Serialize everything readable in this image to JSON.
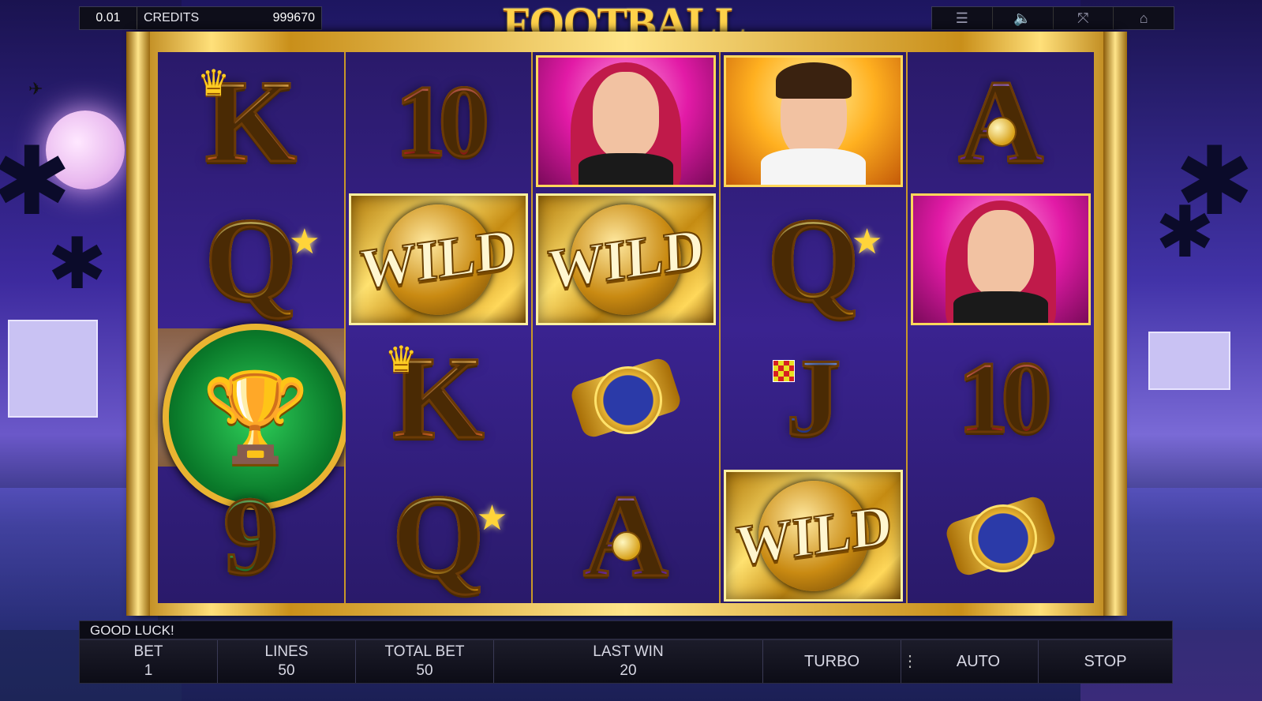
{
  "topbar": {
    "denomination": "0.01",
    "credits_label": "CREDITS",
    "credits_value": "999670",
    "icons": [
      "menu-icon",
      "sound-icon",
      "fullscreen-icon",
      "home-icon"
    ]
  },
  "game": {
    "title": "FOOTBALL SUPERSTAR"
  },
  "reels": [
    {
      "symbols": [
        "K",
        "Q",
        "TROPHY",
        "9"
      ]
    },
    {
      "symbols": [
        "10",
        "WILD",
        "K",
        "Q"
      ]
    },
    {
      "symbols": [
        "GIRL",
        "WILD",
        "WATCH",
        "A"
      ]
    },
    {
      "symbols": [
        "MAN",
        "Q",
        "J",
        "WILD"
      ]
    },
    {
      "symbols": [
        "A",
        "GIRL",
        "10",
        "WATCH"
      ]
    }
  ],
  "symbol_labels": {
    "wild": "WILD",
    "k": "K",
    "q": "Q",
    "a": "A",
    "j": "J",
    "ten": "10",
    "nine": "9"
  },
  "status": {
    "message": "GOOD LUCK!"
  },
  "panel": {
    "bet_label": "BET",
    "bet_value": "1",
    "lines_label": "LINES",
    "lines_value": "50",
    "total_bet_label": "TOTAL BET",
    "total_bet_value": "50",
    "last_win_label": "LAST WIN",
    "last_win_value": "20",
    "turbo_label": "TURBO",
    "auto_label": "AUTO",
    "stop_label": "STOP"
  },
  "colors": {
    "frame_gold": "#e9b431",
    "reel_bg": "#2a1a6a",
    "panel_bg": "#0c0c16"
  }
}
